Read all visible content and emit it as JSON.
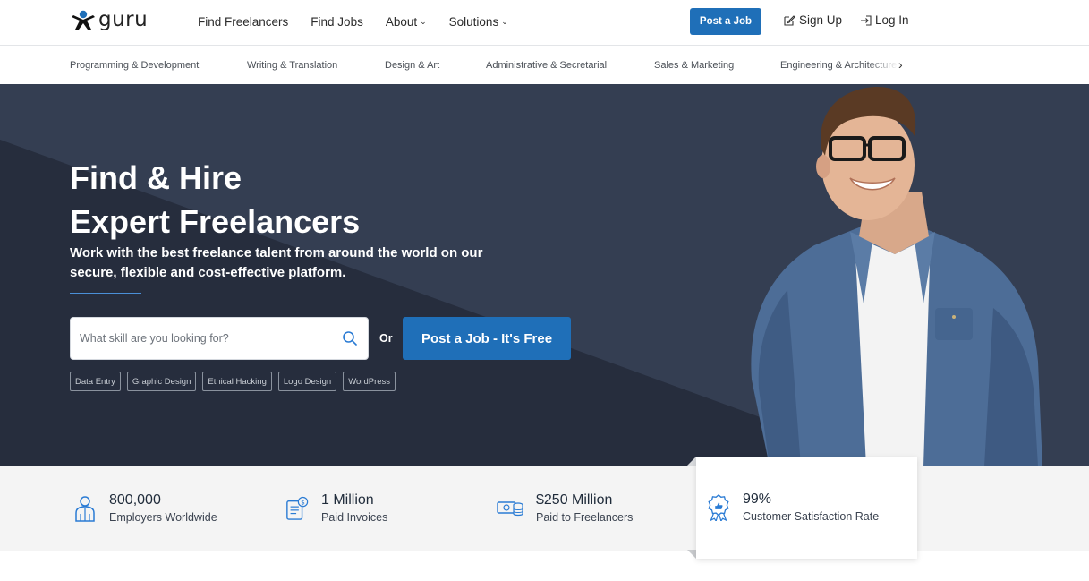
{
  "brand": {
    "name": "guru"
  },
  "nav": {
    "items": [
      {
        "label": "Find Freelancers",
        "dropdown": false
      },
      {
        "label": "Find Jobs",
        "dropdown": false
      },
      {
        "label": "About",
        "dropdown": true
      },
      {
        "label": "Solutions",
        "dropdown": true
      }
    ],
    "post_job_label": "Post a Job",
    "signup_label": "Sign Up",
    "login_label": "Log In"
  },
  "categories": [
    "Programming & Development",
    "Writing & Translation",
    "Design & Art",
    "Administrative & Secretarial",
    "Sales & Marketing",
    "Engineering & Architecture"
  ],
  "hero": {
    "title_line1": "Find & Hire",
    "title_line2": "Expert Freelancers",
    "subtitle": "Work with the best freelance talent from around the world on our secure, flexible and cost-effective platform.",
    "search_placeholder": "What skill are you looking for?",
    "or_label": "Or",
    "post_job_label": "Post a Job - It's Free",
    "tags": [
      "Data Entry",
      "Graphic Design",
      "Ethical Hacking",
      "Logo Design",
      "WordPress"
    ]
  },
  "stats": [
    {
      "value": "800,000",
      "label": "Employers Worldwide",
      "icon": "employer-icon"
    },
    {
      "value": "1 Million",
      "label": "Paid Invoices",
      "icon": "invoice-icon"
    },
    {
      "value": "$250 Million",
      "label": "Paid to Freelancers",
      "icon": "money-icon"
    },
    {
      "value": "99%",
      "label": "Customer Satisfaction Rate",
      "icon": "award-icon"
    }
  ],
  "colors": {
    "accent": "#1f6fb8",
    "hero_bg": "#2e3648",
    "stats_bg": "#f4f4f4"
  }
}
